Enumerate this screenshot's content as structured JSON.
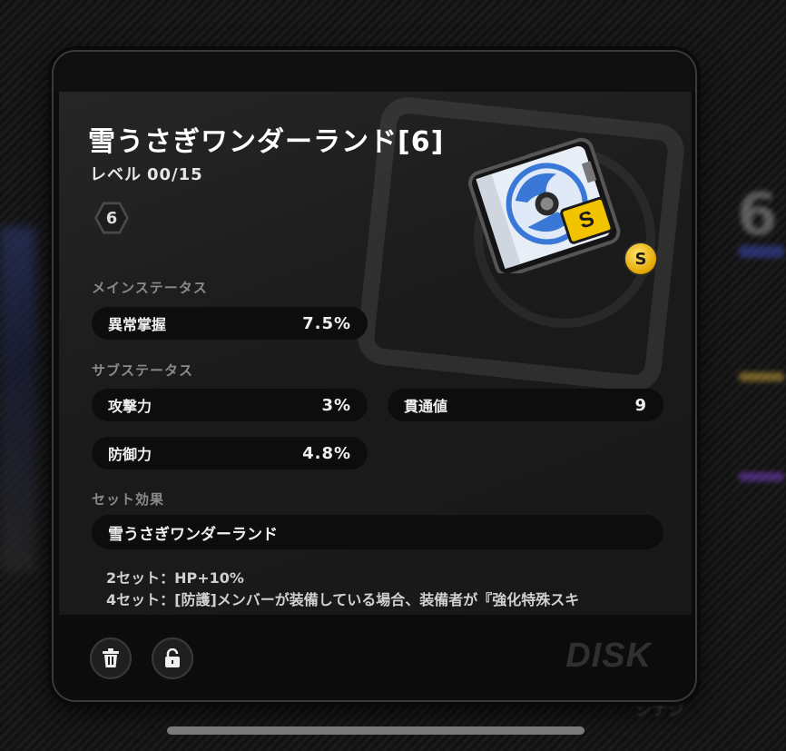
{
  "disk": {
    "title": "雪うさぎワンダーランド[6]",
    "level_label": "レベル",
    "level_value": "00/15",
    "slot": "6",
    "rank": "S"
  },
  "main_stat": {
    "section_label": "メインステータス",
    "name": "異常掌握",
    "value": "7.5%"
  },
  "sub_stats": {
    "section_label": "サブステータス",
    "items": [
      {
        "name": "攻撃力",
        "value": "3%"
      },
      {
        "name": "貫通値",
        "value": "9"
      },
      {
        "name": "防御力",
        "value": "4.8%"
      }
    ]
  },
  "set_effect": {
    "section_label": "セット効果",
    "name": "雪うさぎワンダーランド",
    "bonus_2": "2セット：HP+10%",
    "bonus_4": "4セット：[防護]メンバーが装備している場合、装備者が『強化特殊スキ"
  },
  "footer": {
    "brand_label": "DISK"
  },
  "background": {
    "right_number": "6",
    "bottom_text": "シナジ"
  },
  "colors": {
    "rank_gold": "#e3a600",
    "disk_blue": "#3a78d8",
    "rarity_yellow": "#f2c400"
  },
  "icons": [
    "trash-icon",
    "unlock-icon",
    "chevron-down-icon"
  ]
}
